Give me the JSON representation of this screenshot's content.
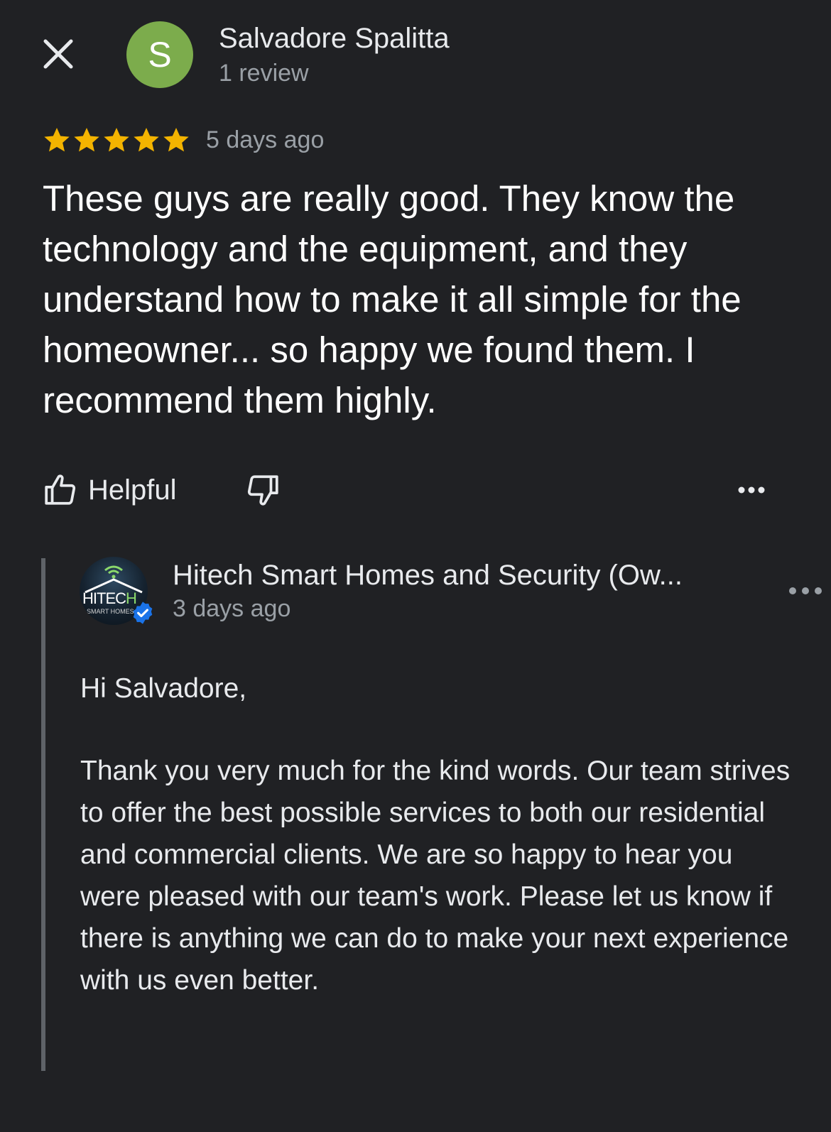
{
  "header": {
    "close_icon": "close-icon",
    "avatar_letter": "S",
    "avatar_color": "#7cac4c",
    "reviewer_name": "Salvadore Spalitta",
    "review_count": "1 review"
  },
  "review": {
    "rating": 5,
    "rating_max": 5,
    "star_color": "#f4b400",
    "date": "5 days ago",
    "text": "These guys are really good. They know the technology and the equipment, and they understand how to make it all simple for the homeowner... so happy we found them. I recommend them highly."
  },
  "actions": {
    "helpful_label": "Helpful",
    "helpful_icon": "thumbs-up-icon",
    "dislike_icon": "thumbs-down-icon",
    "more_icon": "more-horizontal-icon"
  },
  "reply": {
    "owner_name": "Hitech Smart Homes and Security (Ow...",
    "date": "3 days ago",
    "logo_word": "HITEC",
    "logo_word_tail": "H",
    "logo_subtext": "SMART HOMES & SE",
    "verified_icon": "verified-check-icon",
    "verified_color": "#1a73e8",
    "greeting": "Hi Salvadore,",
    "body": "Thank you very much for the kind words. Our team strives to offer the best possible services to both our residential and commercial clients. We are so happy to hear you were pleased with our team's work. Please let us know if there is anything we can do to make your next experience with us even better."
  }
}
